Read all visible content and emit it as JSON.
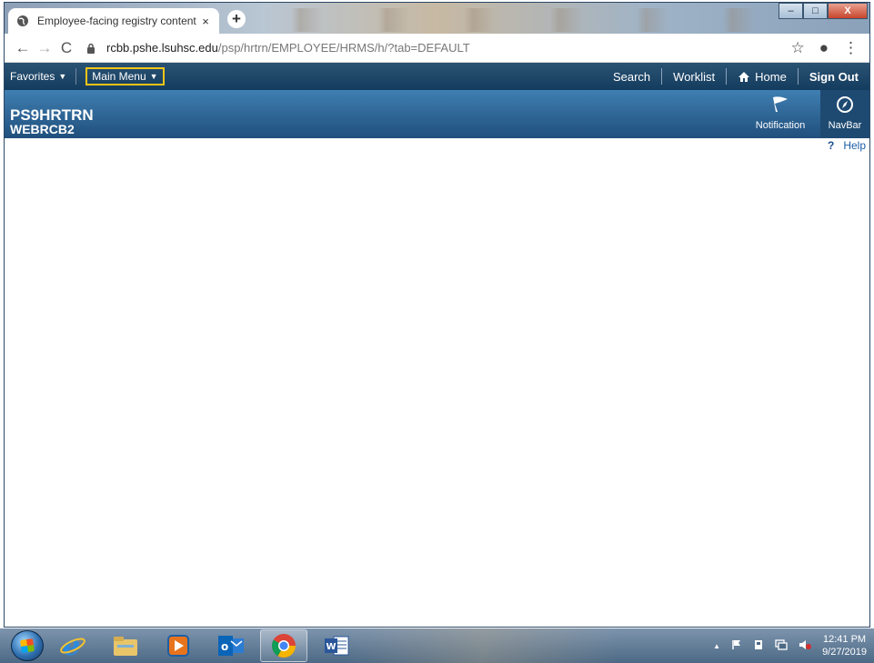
{
  "browser": {
    "tab_title": "Employee-facing registry content",
    "tab_close": "×",
    "new_tab": "+",
    "url_host": "rcbb.pshe.lsuhsc.edu",
    "url_path": "/psp/hrtrn/EMPLOYEE/HRMS/h/?tab=DEFAULT",
    "back": "←",
    "forward": "→",
    "reload": "C",
    "star": "☆",
    "account": "●",
    "menu": "⋮",
    "min": "–",
    "max": "□",
    "close": "X"
  },
  "ps_nav": {
    "favorites": "Favorites",
    "main_menu": "Main Menu",
    "search": "Search",
    "worklist": "Worklist",
    "home": "Home",
    "sign_out": "Sign Out"
  },
  "ps_banner": {
    "database": "PS9HRTRN",
    "server": "WEBRCB2",
    "notification": "Notification",
    "navbar": "NavBar",
    "help": "Help",
    "help_q": "?"
  },
  "taskbar": {
    "apps": [
      "start-orb",
      "internet-explorer-icon",
      "file-explorer-icon",
      "media-player-icon",
      "outlook-icon",
      "chrome-icon",
      "word-icon"
    ],
    "time": "12:41 PM",
    "date": "9/27/2019",
    "tray_arrow": "▲"
  },
  "colors": {
    "ps_topbar": "#143c5e",
    "ps_banner": "#3f7fb2",
    "highlight": "#f5c518"
  }
}
